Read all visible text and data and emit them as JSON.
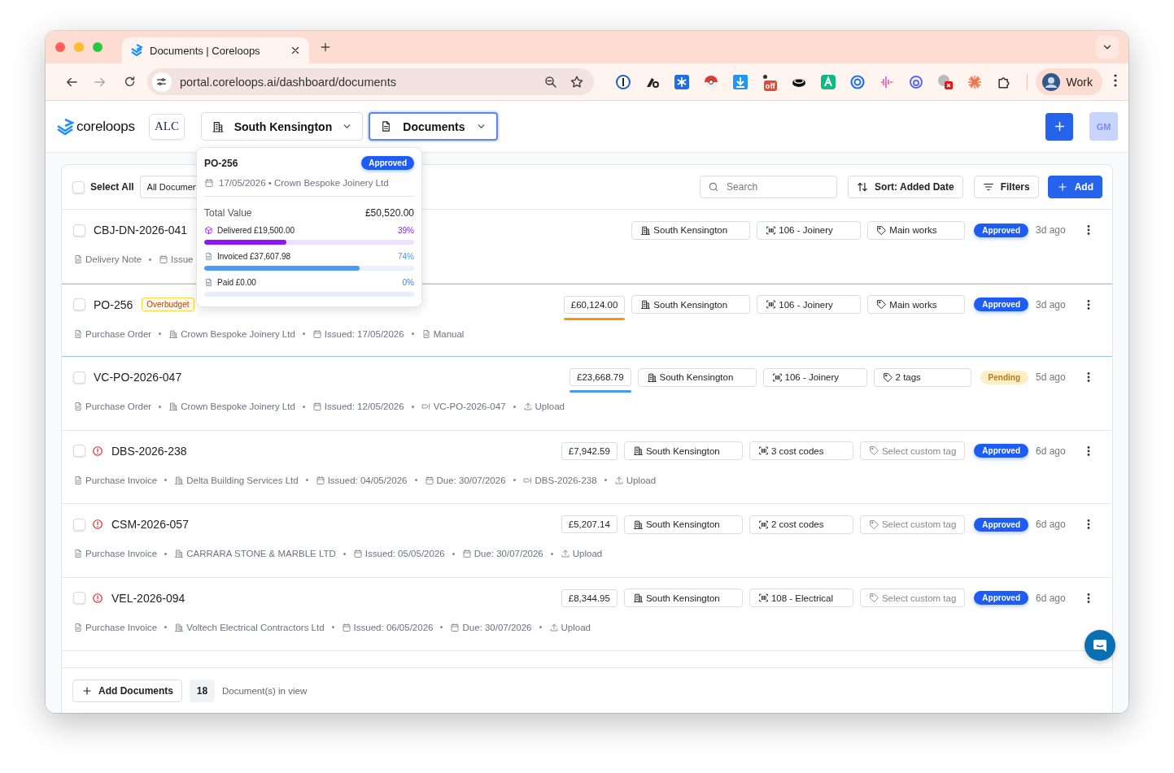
{
  "browser": {
    "tab_title": "Documents | Coreloops",
    "url": "portal.coreloops.ai/dashboard/documents",
    "extension_badge": "off",
    "profile": "Work"
  },
  "header": {
    "brand": "coreloops",
    "client_logo": "ALC",
    "site_select": "South Kensington",
    "view_select": "Documents",
    "avatar": "GM"
  },
  "toolbar": {
    "select_all": {
      "label": "Select All",
      "checked": false
    },
    "filter": "All Documen",
    "search_placeholder": "Search",
    "sort": "Sort: Added Date",
    "filters": "Filters",
    "add": "Add"
  },
  "rows": [
    {
      "id": "CBJ-DN-2026-041",
      "alert": false,
      "checked": false,
      "selected": false,
      "site": "South Kensington",
      "cost": "106 - Joinery",
      "tag": {
        "text": "Main works",
        "kind": "set"
      },
      "status": {
        "text": "Approved",
        "kind": "approved"
      },
      "age": "3d ago",
      "meta": [
        {
          "kind": "document",
          "text": "Delivery Note"
        },
        {
          "kind": "calendar",
          "text": "Issue"
        }
      ]
    },
    {
      "id": "PO-256",
      "alert": false,
      "checked": false,
      "selected": true,
      "badge": "Overbudget",
      "amount": {
        "text": "£60,124.00",
        "color": "#ff9500"
      },
      "site": "South Kensington",
      "cost": "106 - Joinery",
      "tag": {
        "text": "Main works",
        "kind": "set"
      },
      "status": {
        "text": "Approved",
        "kind": "approved"
      },
      "age": "3d ago",
      "meta": [
        {
          "kind": "document",
          "text": "Purchase Order"
        },
        {
          "kind": "building",
          "text": "Crown Bespoke Joinery Ltd"
        },
        {
          "kind": "calendar",
          "text": "Issued: 17/05/2026"
        },
        {
          "kind": "document",
          "text": "Manual"
        }
      ]
    },
    {
      "id": "VC-PO-2026-047",
      "alert": false,
      "checked": false,
      "selected": false,
      "amount": {
        "text": "£23,668.79",
        "color": "#4a9af5"
      },
      "site": "South Kensington",
      "cost": "106 - Joinery",
      "tag": {
        "text": "2 tags",
        "kind": "set"
      },
      "status": {
        "text": "Pending",
        "kind": "pending"
      },
      "age": "5d ago",
      "meta": [
        {
          "kind": "document",
          "text": "Purchase Order"
        },
        {
          "kind": "building",
          "text": "Crown Bespoke Joinery Ltd"
        },
        {
          "kind": "calendar",
          "text": "Issued: 12/05/2026"
        },
        {
          "kind": "reference",
          "text": "VC-PO-2026-047"
        },
        {
          "kind": "upload",
          "text": "Upload"
        }
      ]
    },
    {
      "id": "DBS-2026-238",
      "alert": true,
      "checked": false,
      "selected": false,
      "amount": {
        "text": "£7,942.59"
      },
      "site": "South Kensington",
      "cost": "3 cost codes",
      "tag": {
        "text": "Select custom tag",
        "kind": "placeholder"
      },
      "status": {
        "text": "Approved",
        "kind": "approved"
      },
      "age": "6d ago",
      "meta": [
        {
          "kind": "document",
          "text": "Purchase Invoice"
        },
        {
          "kind": "building",
          "text": "Delta Building Services Ltd"
        },
        {
          "kind": "calendar",
          "text": "Issued: 04/05/2026"
        },
        {
          "kind": "calendar",
          "text": "Due: 30/07/2026"
        },
        {
          "kind": "reference",
          "text": "DBS-2026-238"
        },
        {
          "kind": "upload",
          "text": "Upload"
        }
      ]
    },
    {
      "id": "CSM-2026-057",
      "alert": true,
      "checked": false,
      "selected": false,
      "amount": {
        "text": "£5,207.14"
      },
      "site": "South Kensington",
      "cost": "2 cost codes",
      "tag": {
        "text": "Select custom tag",
        "kind": "placeholder"
      },
      "status": {
        "text": "Approved",
        "kind": "approved"
      },
      "age": "6d ago",
      "meta": [
        {
          "kind": "document",
          "text": "Purchase Invoice"
        },
        {
          "kind": "building",
          "text": "CARRARA STONE & MARBLE LTD"
        },
        {
          "kind": "calendar",
          "text": "Issued: 05/05/2026"
        },
        {
          "kind": "calendar",
          "text": "Due: 30/07/2026"
        },
        {
          "kind": "upload",
          "text": "Upload"
        }
      ]
    },
    {
      "id": "VEL-2026-094",
      "alert": true,
      "checked": false,
      "selected": false,
      "amount": {
        "text": "£8,344.95"
      },
      "site": "South Kensington",
      "cost": "108 - Electrical",
      "tag": {
        "text": "Select custom tag",
        "kind": "placeholder"
      },
      "status": {
        "text": "Approved",
        "kind": "approved"
      },
      "age": "6d ago",
      "meta": [
        {
          "kind": "document",
          "text": "Purchase Invoice"
        },
        {
          "kind": "building",
          "text": "Voltech Electrical Contractors Ltd"
        },
        {
          "kind": "calendar",
          "text": "Issued: 06/05/2026"
        },
        {
          "kind": "calendar",
          "text": "Due: 30/07/2026"
        },
        {
          "kind": "upload",
          "text": "Upload"
        }
      ]
    }
  ],
  "footer": {
    "add_documents": "Add Documents",
    "count": "18",
    "count_label": "Document(s) in view"
  },
  "popover": {
    "title": "PO-256",
    "status": {
      "text": "Approved",
      "kind": "approved"
    },
    "subtitle": "17/05/2026 • Crown Bespoke Joinery Ltd",
    "total_label": "Total Value",
    "total": "£50,520.00",
    "bars": [
      {
        "kind": "delivered",
        "label": "Delivered £19,500.00",
        "percent": "39%",
        "level": 0.39
      },
      {
        "kind": "invoiced",
        "label": "Invoiced £37,607.98",
        "percent": "74%",
        "level": 0.74
      },
      {
        "kind": "paid",
        "label": "Paid £0.00",
        "percent": "0%",
        "level": 0
      }
    ]
  }
}
